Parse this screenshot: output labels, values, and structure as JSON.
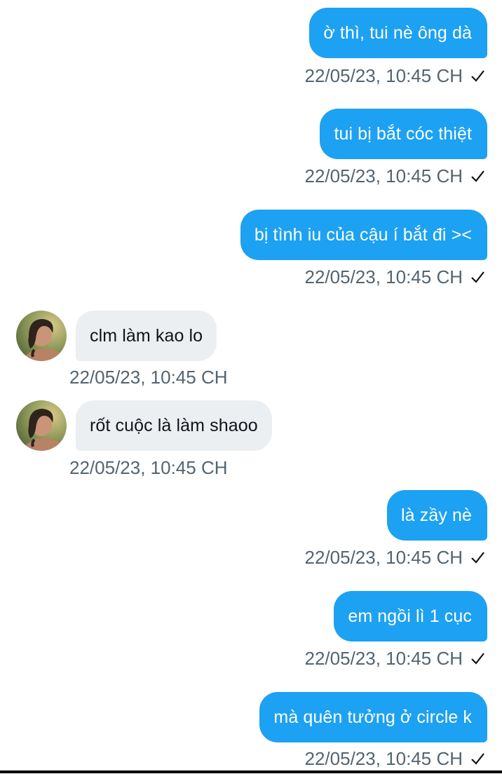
{
  "conversation": {
    "messages": [
      {
        "direction": "sent",
        "text": "ờ thì, tui nè ông dà",
        "timestamp": "22/05/23, 10:45 CH",
        "seen_icon": "check-icon"
      },
      {
        "direction": "sent",
        "text": "tui bị bắt cóc thiệt",
        "timestamp": "22/05/23, 10:45 CH",
        "seen_icon": "check-icon"
      },
      {
        "direction": "sent",
        "text": "bị tình iu của cậu í bắt đi ><",
        "timestamp": "22/05/23, 10:45 CH",
        "seen_icon": "check-icon"
      },
      {
        "direction": "received",
        "text": "clm làm kao lo",
        "timestamp": "22/05/23, 10:45 CH",
        "avatar_icon": "avatar-photo-icon"
      },
      {
        "direction": "received",
        "text": "rốt cuộc là làm shaoo",
        "timestamp": "22/05/23, 10:45 CH",
        "avatar_icon": "avatar-photo-icon"
      },
      {
        "direction": "sent",
        "text": "là zầy nè",
        "timestamp": "22/05/23, 10:45 CH",
        "seen_icon": "check-icon"
      },
      {
        "direction": "sent",
        "text": "em ngồi lì 1 cục",
        "timestamp": "22/05/23, 10:45 CH",
        "seen_icon": "check-icon"
      },
      {
        "direction": "sent",
        "text": "mà quên tưởng ở circle k",
        "timestamp": "22/05/23, 10:45 CH",
        "seen_icon": "check-icon"
      }
    ]
  },
  "colors": {
    "sent_bubble": "#1da1f2",
    "received_bubble": "#eceff1",
    "timestamp_text": "#536471"
  }
}
